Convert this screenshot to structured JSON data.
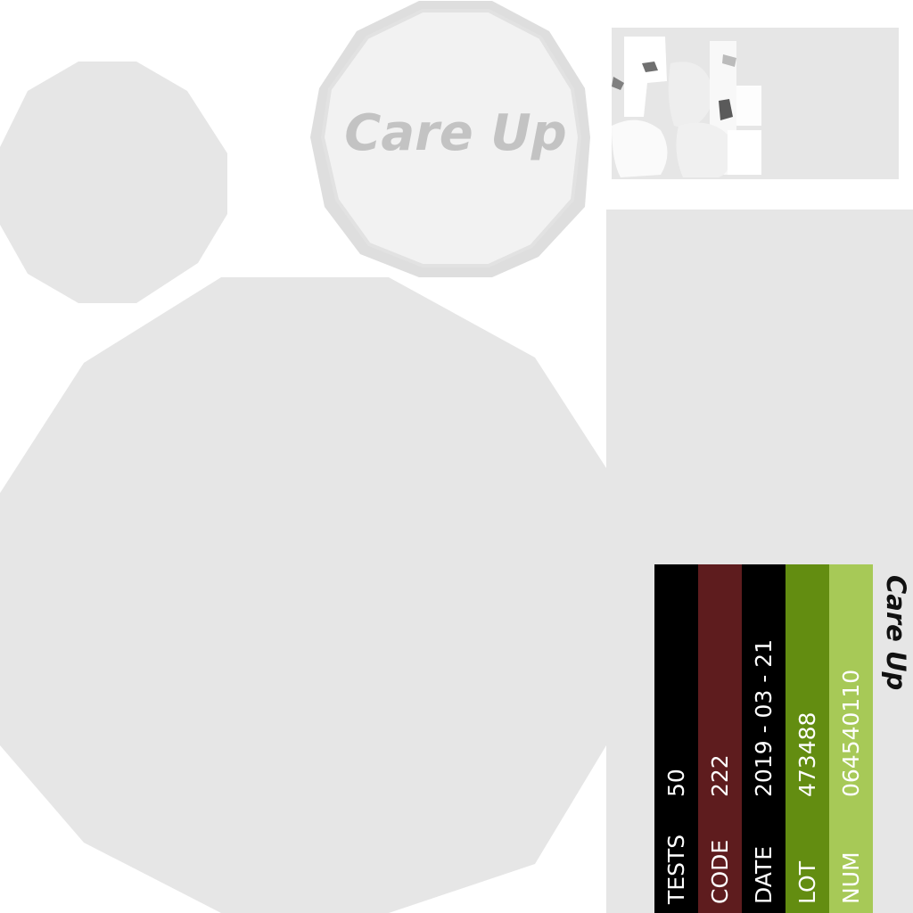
{
  "brand": {
    "cap_logo": "Care Up",
    "side_logo": "Care Up"
  },
  "label_rows": [
    {
      "label": "TESTS",
      "value": "50",
      "color": "#000000"
    },
    {
      "label": "CODE",
      "value": "222",
      "color": "#5e1c1e"
    },
    {
      "label": "DATE",
      "value": "2019 - 03 - 21",
      "color": "#000000"
    },
    {
      "label": "LOT",
      "value": "473488",
      "color": "#638d11"
    },
    {
      "label": "NUM",
      "value": "064540110",
      "color": "#a7c957"
    }
  ],
  "colors": {
    "background": "#ffffff",
    "panel": "#e6e6e6",
    "cap_text": "#c3c3c3",
    "logo_text": "#111111"
  }
}
